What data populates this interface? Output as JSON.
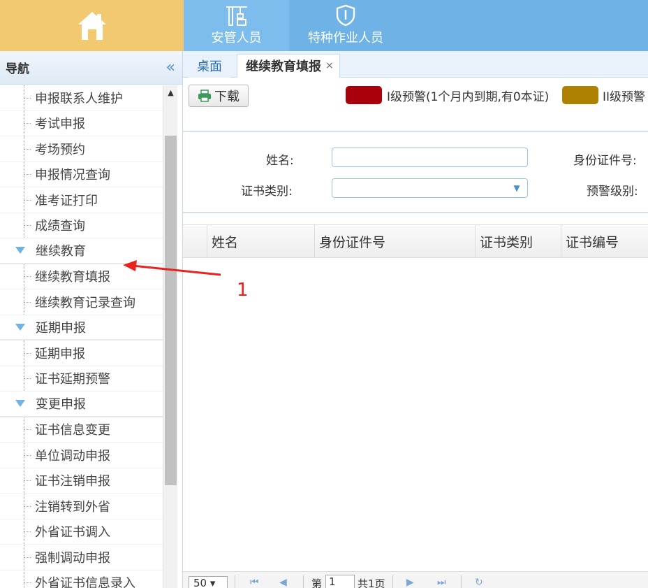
{
  "topnav": {
    "home_icon": "home-icon",
    "items": [
      {
        "label": "安管人员",
        "icon": "crane-icon"
      },
      {
        "label": "特种作业人员",
        "icon": "shield-icon"
      }
    ]
  },
  "sidebar": {
    "title": "导航",
    "collapse_icon": "«",
    "items": [
      {
        "label": "申报联系人维护",
        "type": "leaf"
      },
      {
        "label": "考试申报",
        "type": "leaf"
      },
      {
        "label": "考场预约",
        "type": "leaf"
      },
      {
        "label": "申报情况查询",
        "type": "leaf"
      },
      {
        "label": "准考证打印",
        "type": "leaf"
      },
      {
        "label": "成绩查询",
        "type": "leaf"
      },
      {
        "label": "继续教育",
        "type": "group"
      },
      {
        "label": "继续教育填报",
        "type": "leaf"
      },
      {
        "label": "继续教育记录查询",
        "type": "leaf"
      },
      {
        "label": "延期申报",
        "type": "group"
      },
      {
        "label": "延期申报",
        "type": "leaf"
      },
      {
        "label": "证书延期预警",
        "type": "leaf"
      },
      {
        "label": "变更申报",
        "type": "group"
      },
      {
        "label": "证书信息变更",
        "type": "leaf"
      },
      {
        "label": "单位调动申报",
        "type": "leaf"
      },
      {
        "label": "证书注销申报",
        "type": "leaf"
      },
      {
        "label": "注销转到外省",
        "type": "leaf"
      },
      {
        "label": "外省证书调入",
        "type": "leaf"
      },
      {
        "label": "强制调动申报",
        "type": "leaf"
      },
      {
        "label": "外省证书信息录入",
        "type": "leaf"
      }
    ]
  },
  "tabs": [
    {
      "label": "桌面"
    },
    {
      "label": "继续教育填报",
      "close": "×"
    }
  ],
  "toolbar": {
    "download_label": "下载",
    "legend1": {
      "color": "#a9000b",
      "text": "I级预警(1个月内到期,有0本证)"
    },
    "legend2": {
      "color": "#ae8100",
      "text": "II级预警"
    }
  },
  "form": {
    "name_label": "姓名:",
    "id_label": "身份证件号:",
    "cert_type_label": "证书类别:",
    "warn_level_label": "预警级别:",
    "name_value": "",
    "cert_type_value": ""
  },
  "grid": {
    "columns": [
      "姓名",
      "身份证件号",
      "证书类别",
      "证书编号"
    ]
  },
  "pager": {
    "page_size": "50",
    "page_prefix": "第",
    "page_value": "1",
    "page_total": "共1页"
  },
  "annotation": {
    "number": "1"
  }
}
